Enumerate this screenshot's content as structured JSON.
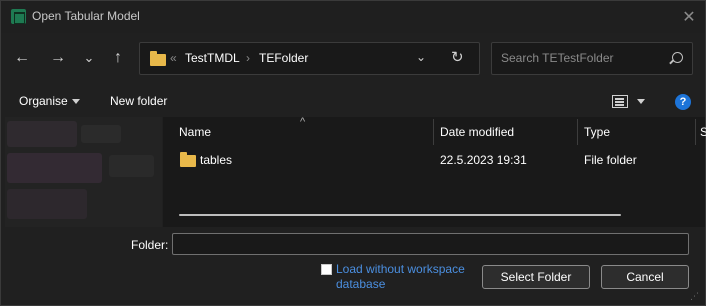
{
  "window": {
    "title": "Open Tabular Model",
    "icon": "tabular-editor-icon",
    "close_glyph": "✕"
  },
  "nav": {
    "back_glyph": "←",
    "forward_glyph": "→",
    "recent_glyph": "⌄",
    "up_glyph": "↑"
  },
  "address": {
    "overflow_glyph": "«",
    "separator_glyph": "›",
    "breadcrumbs": [
      "TestTMDL",
      "TEFolder"
    ],
    "dropdown_glyph": "⌄",
    "refresh_glyph": "↻"
  },
  "search": {
    "placeholder": "Search TETestFolder"
  },
  "commands": {
    "organise": "Organise",
    "new_folder": "New folder",
    "help": "?"
  },
  "columns": {
    "sort_glyph": "^",
    "name": "Name",
    "date_modified": "Date modified",
    "type": "Type",
    "size": "S"
  },
  "files": [
    {
      "name": "tables",
      "date_modified": "22.5.2023 19:31",
      "type": "File folder",
      "icon": "folder-icon"
    }
  ],
  "footer": {
    "folder_label": "Folder:",
    "folder_value": "",
    "checkbox_label": "Load without workspace database",
    "checkbox_checked": false,
    "select_button": "Select Folder",
    "cancel_button": "Cancel"
  },
  "colors": {
    "background": "#202020",
    "pane": "#191919",
    "folder": "#e8b84a",
    "link": "#4b8fe0",
    "help": "#1d74d8",
    "app_icon": "#1e7a52"
  }
}
